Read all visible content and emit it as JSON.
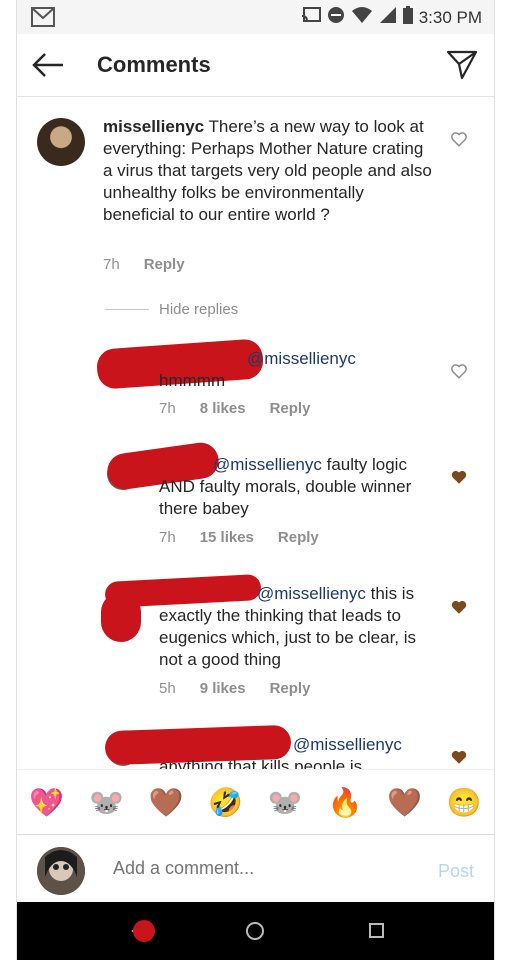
{
  "statusbar": {
    "time": "3:30 PM",
    "icons": [
      "gmail-icon",
      "cast-icon",
      "dnd-icon",
      "wifi-icon",
      "signal-icon",
      "battery-icon"
    ]
  },
  "header": {
    "title": "Comments",
    "back_icon": "back-arrow-icon",
    "send_icon": "direct-send-icon"
  },
  "main_comment": {
    "username": "missellienyc",
    "text": "There’s a new way to look at everything: Perhaps Mother Nature crating a virus that targets very old people and also unhealthy folks be environmentally beneficial to our entire world ?",
    "time": "7h",
    "reply": "Reply"
  },
  "hide_replies": "Hide replies",
  "replies": [
    {
      "mention": "@missellienyc",
      "text": "hmmmm",
      "time": "7h",
      "likes": "8 likes",
      "reply": "Reply",
      "liked": false
    },
    {
      "mention": "@missellienyc",
      "text": "faulty logic AND faulty morals, double winner there babey",
      "time": "7h",
      "likes": "15 likes",
      "reply": "Reply",
      "liked": true
    },
    {
      "mention": "@missellienyc",
      "text": "this is exactly the thinking that leads to eugenics which, just to be clear, is not a good thing",
      "time": "5h",
      "likes": "9 likes",
      "reply": "Reply",
      "liked": true
    },
    {
      "mention": "@missellienyc",
      "text": "anything that kills people is",
      "liked": true
    }
  ],
  "emoji_bar": [
    "💖",
    "🐭",
    "🤎",
    "🤣",
    "🐭",
    "🔥",
    "🤎",
    "😁"
  ],
  "composer": {
    "placeholder": "Add a comment...",
    "post_label": "Post"
  },
  "colors": {
    "liked_heart": "#7a4a1c",
    "redaction": "#c8141a",
    "mention": "#1d3a6b"
  }
}
